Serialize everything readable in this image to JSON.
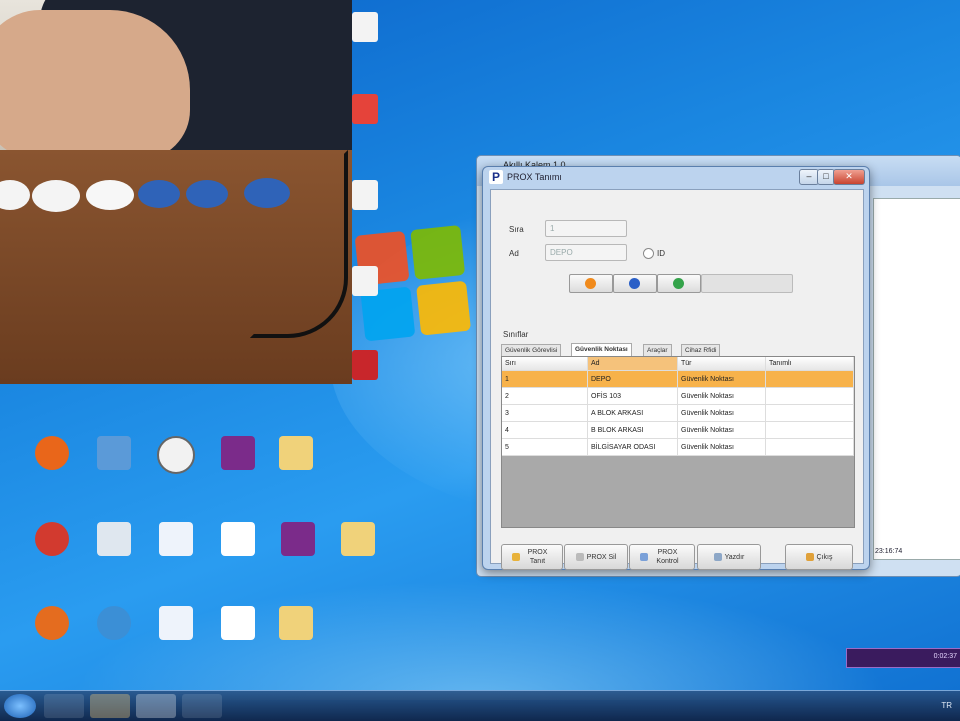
{
  "background_window": {
    "title": "Akıllı Kalem 1.0",
    "status_text": "23:16:74"
  },
  "prox_window": {
    "title": "PROX Tanımı",
    "controls": {
      "minimize": "–",
      "maximize": "□",
      "close": "✕"
    },
    "form": {
      "sira_label": "Sıra",
      "sira_value": "1",
      "ad_label": "Ad",
      "ad_value": "DEPO",
      "radio_label": "ID"
    },
    "toolbar": [
      {
        "name": "add",
        "color": "#f08a1c"
      },
      {
        "name": "delete",
        "color": "#2a5fc7"
      },
      {
        "name": "refresh",
        "color": "#34a34a"
      }
    ],
    "section_label": "Sınıflar",
    "tabs": [
      {
        "label": "Güvenlik Görevlisi",
        "active": false
      },
      {
        "label": "Güvenlik Noktası",
        "active": true
      },
      {
        "label": "Araçlar",
        "active": false
      },
      {
        "label": "Cihaz Rfidi",
        "active": false
      }
    ],
    "grid": {
      "columns": [
        "Sırı",
        "Ad",
        "Tür",
        "Tanımlı"
      ],
      "rows": [
        {
          "no": "1",
          "ad": "DEPO",
          "tur": "Güvenlik Noktası",
          "tanim": "",
          "selected": true
        },
        {
          "no": "2",
          "ad": "OFİS 103",
          "tur": "Güvenlik Noktası",
          "tanim": "",
          "selected": false
        },
        {
          "no": "3",
          "ad": "A BLOK ARKASI",
          "tur": "Güvenlik Noktası",
          "tanim": "",
          "selected": false
        },
        {
          "no": "4",
          "ad": "B BLOK ARKASI",
          "tur": "Güvenlik Noktası",
          "tanim": "",
          "selected": false
        },
        {
          "no": "5",
          "ad": "BİLGİSAYAR ODASI",
          "tur": "Güvenlik Noktası",
          "tanim": "",
          "selected": false
        }
      ]
    },
    "buttons": {
      "prox_tanit": "PROX Tanıt",
      "prox_sil": "PROX Sil",
      "prox_kontrol": "PROX Kontrol",
      "yazdir": "Yazdır",
      "cikis": "Çıkış"
    }
  },
  "media_bar": {
    "time": "0:02:37"
  },
  "tray": {
    "lang": "TR"
  },
  "colors": {
    "selection": "#f7b24a",
    "desktop": "#1a86e0"
  }
}
